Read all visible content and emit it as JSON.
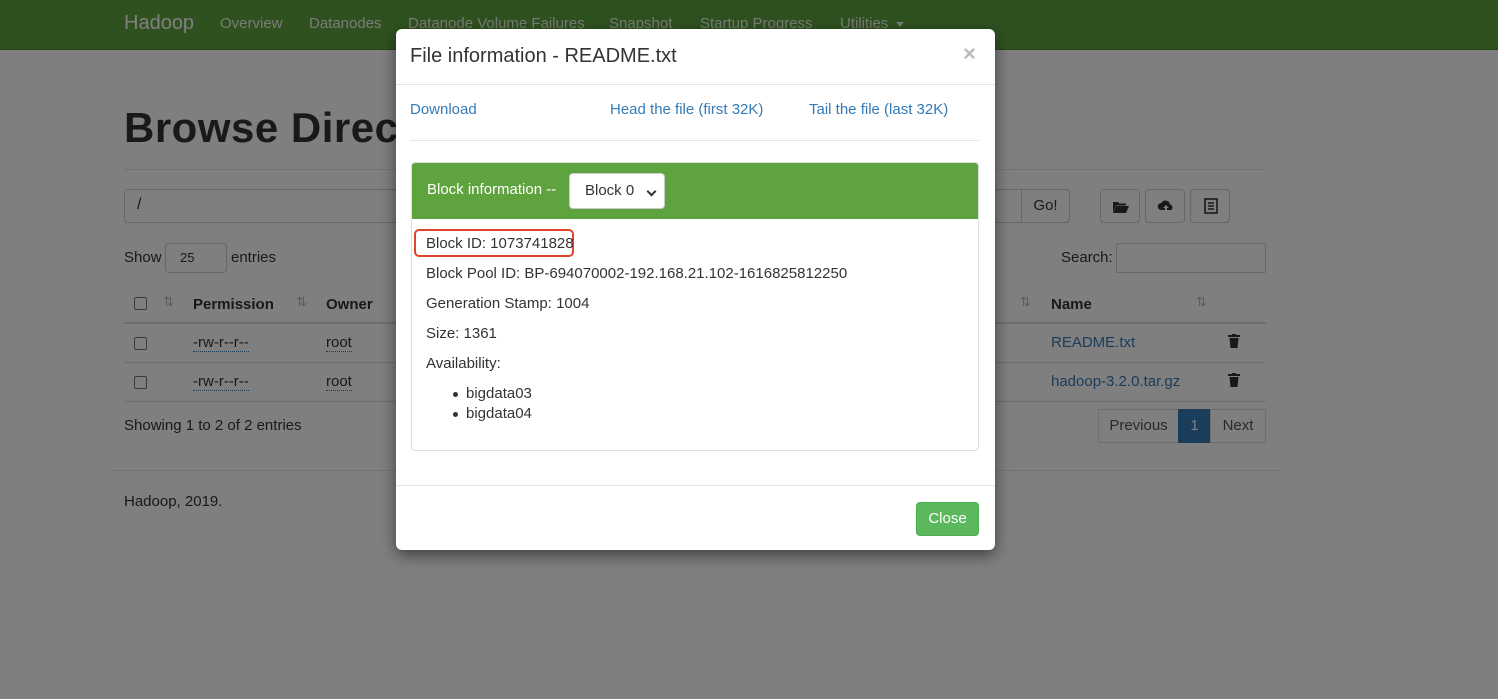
{
  "navbar": {
    "brand": "Hadoop",
    "items": [
      "Overview",
      "Datanodes",
      "Datanode Volume Failures",
      "Snapshot",
      "Startup Progress",
      "Utilities"
    ],
    "bg_color": "#5fa33e"
  },
  "page": {
    "title": "Browse Directory",
    "path_value": "/",
    "go_label": "Go!",
    "toolbar_icons": [
      "folder-open-icon",
      "cloud-upload-icon",
      "list-icon"
    ],
    "show_label": "Show",
    "entries_select_value": "25",
    "entries_label": "entries",
    "search_label": "Search:",
    "columns": [
      "Permission",
      "Owner",
      "Name"
    ],
    "rows": [
      {
        "permission": "-rw-r--r--",
        "owner": "root",
        "name": "README.txt"
      },
      {
        "permission": "-rw-r--r--",
        "owner": "root",
        "name": "hadoop-3.2.0.tar.gz"
      }
    ],
    "showing_text": "Showing 1 to 2 of 2 entries",
    "pagination": {
      "previous": "Previous",
      "current": "1",
      "next": "Next"
    },
    "footer": "Hadoop, 2019."
  },
  "modal": {
    "title": "File information - README.txt",
    "close_symbol": "×",
    "links": {
      "download": "Download",
      "head": "Head the file (first 32K)",
      "tail": "Tail the file (last 32K)"
    },
    "block_info_label": "Block information --",
    "block_select_value": "Block 0",
    "block_id": "Block ID: 1073741828",
    "block_pool_id": "Block Pool ID: BP-694070002-192.168.21.102-1616825812250",
    "generation_stamp": "Generation Stamp: 1004",
    "size": "Size: 1361",
    "availability_label": "Availability:",
    "availability": [
      "bigdata03",
      "bigdata04"
    ],
    "close_button": "Close",
    "highlight_color": "#e0452c"
  }
}
